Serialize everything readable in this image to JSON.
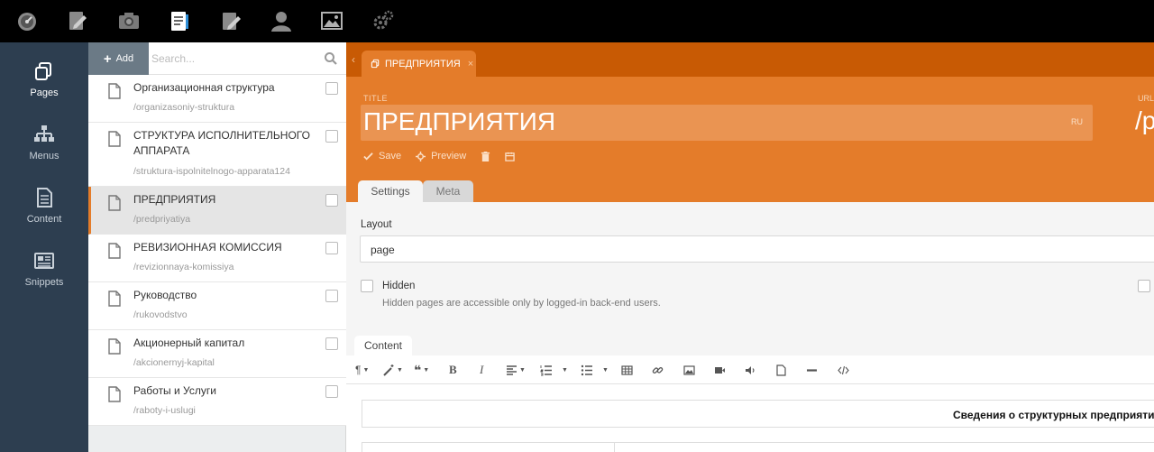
{
  "topbar": {
    "icons": [
      "dashboard-icon",
      "blog-edit-icon",
      "media-camera-icon",
      "pages-document-icon",
      "edit-icon",
      "user-icon",
      "image-icon",
      "settings-gears-icon"
    ]
  },
  "leftnav": {
    "items": [
      {
        "label": "Pages",
        "icon": "pages-icon",
        "active": true
      },
      {
        "label": "Menus",
        "icon": "sitemap-icon",
        "active": false
      },
      {
        "label": "Content",
        "icon": "content-file-icon",
        "active": false
      },
      {
        "label": "Snippets",
        "icon": "newspaper-icon",
        "active": false
      }
    ]
  },
  "list": {
    "add_label": "Add",
    "search_placeholder": "Search...",
    "pages": [
      {
        "title": "Организационная структура",
        "url": "/organizasoniy-struktura"
      },
      {
        "title": "СТРУКТУРА ИСПОЛНИТЕЛЬНОГО АППАРАТА",
        "url": "/struktura-ispolnitelnogo-apparata124"
      },
      {
        "title": "ПРЕДПРИЯТИЯ",
        "url": "/predpriyatiya"
      },
      {
        "title": "РЕВИЗИОННАЯ КОМИССИЯ",
        "url": "/revizionnaya-komissiya"
      },
      {
        "title": "Руководство",
        "url": "/rukovodstvo"
      },
      {
        "title": "Акционерный капитал",
        "url": "/akcionernyj-kapital"
      },
      {
        "title": "Работы и Услуги",
        "url": "/raboty-i-uslugi"
      }
    ]
  },
  "editor": {
    "back_glyph": "‹",
    "tab_label": "ПРЕДПРИЯТИЯ",
    "tab_close": "×",
    "title_label": "TITLE",
    "title_value": "ПРЕДПРИЯТИЯ",
    "lang_badge": "RU",
    "url_label": "URL",
    "url_value": "/p",
    "save_label": "Save",
    "preview_label": "Preview",
    "tabs": {
      "settings": "Settings",
      "meta": "Meta"
    },
    "layout_label": "Layout",
    "layout_value": "page",
    "hidden_label": "Hidden",
    "hidden_help": "Hidden pages are accessible only by logged-in back-end users.",
    "content_tab": "Content",
    "table_caption": "Сведения о структурных предприятиях"
  },
  "colors": {
    "accent": "#e47c2a",
    "accent_dark": "#c85a04",
    "nav_bg": "#2d3e50"
  }
}
